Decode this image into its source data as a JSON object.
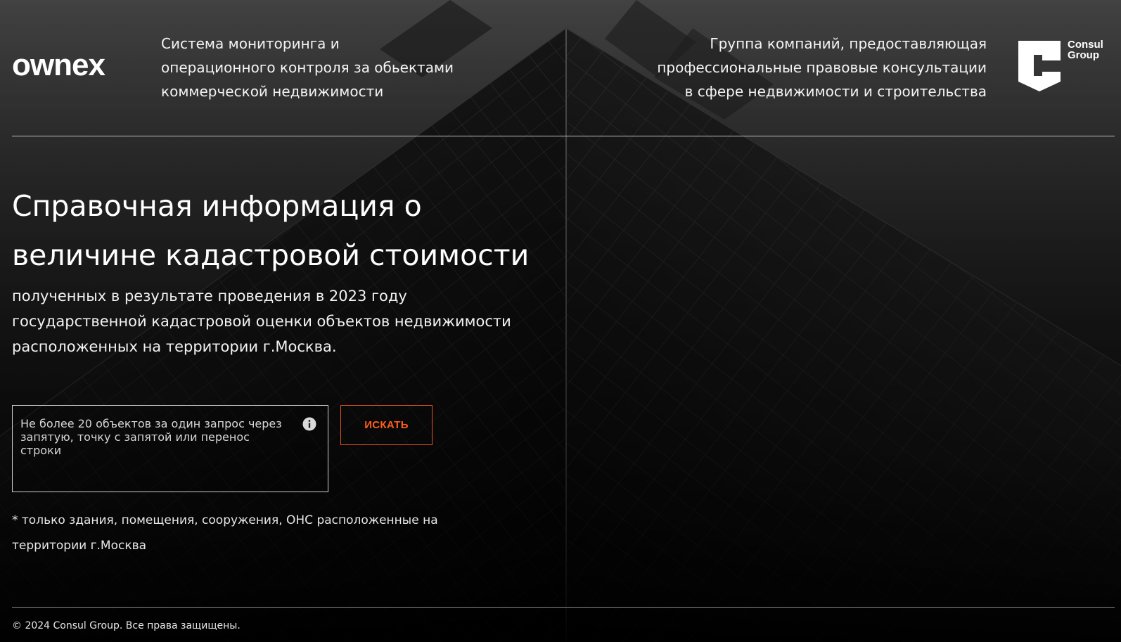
{
  "header": {
    "logo_text": "ownex",
    "tagline": "Система мониторинга и операционного контроля за обьектами коммерческой недвижимости",
    "company_description": "Группа компаний, предоставляющая профессиональные правовые консультации в сфере недвижимости и строительства",
    "consul_logo_line1": "Consul",
    "consul_logo_line2": "Group"
  },
  "main": {
    "title": "Справочная информация о величине кадастровой стоимости",
    "subtitle": "полученных в результате проведения в 2023 году государственной кадастровой оценки объектов недвижимости расположенных на территории г.Москва.",
    "search": {
      "value": "",
      "placeholder": "Не более 20 объектов за один запрос через запятую, точку с запятой или перенос строки",
      "button_label": "ИСКАТЬ",
      "info_icon": "info-icon"
    },
    "note": "* только здания, помещения, сооружения, ОНС расположенные на территории г.Москва"
  },
  "footer": {
    "copyright": "© 2024 Consul Group. Все права защищены."
  },
  "colors": {
    "accent": "#ff5e1a",
    "background": "#111111",
    "text": "#f2f2f2"
  }
}
